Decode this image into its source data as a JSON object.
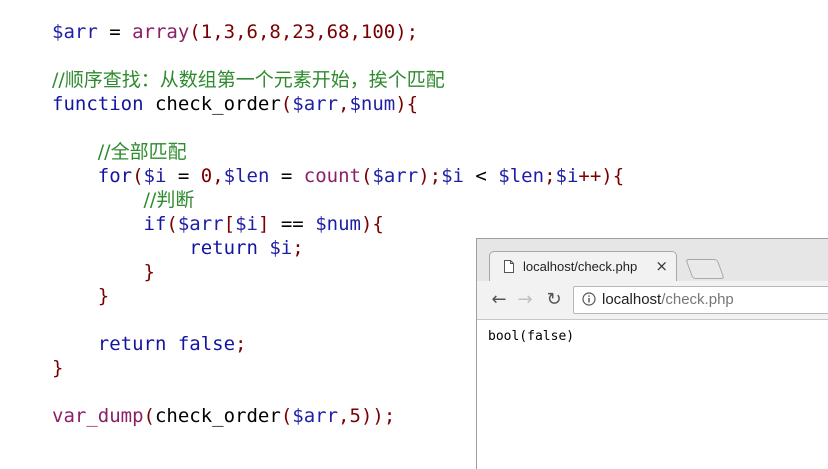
{
  "code_lines": [
    {
      "tokens": [
        [
          "v",
          "$arr"
        ],
        [
          "t",
          " = "
        ],
        [
          "f",
          "array"
        ],
        [
          "p",
          "("
        ],
        [
          "n",
          "1,3,6,8,23,68,100"
        ],
        [
          "p",
          ");"
        ]
      ]
    },
    {
      "tokens": []
    },
    {
      "tokens": [
        [
          "c",
          "//顺序查找：从数组第一个元素开始，挨个匹配"
        ]
      ]
    },
    {
      "tokens": [
        [
          "k",
          "function "
        ],
        [
          "t",
          "check_order"
        ],
        [
          "p",
          "("
        ],
        [
          "v",
          "$arr"
        ],
        [
          "p",
          ","
        ],
        [
          "v",
          "$num"
        ],
        [
          "p",
          "){"
        ]
      ]
    },
    {
      "tokens": []
    },
    {
      "tokens": [
        [
          "t",
          "    "
        ],
        [
          "c",
          "//全部匹配"
        ]
      ]
    },
    {
      "tokens": [
        [
          "t",
          "    "
        ],
        [
          "k",
          "for"
        ],
        [
          "p",
          "("
        ],
        [
          "v",
          "$i"
        ],
        [
          "t",
          " = "
        ],
        [
          "n",
          "0"
        ],
        [
          "p",
          ","
        ],
        [
          "v",
          "$len"
        ],
        [
          "t",
          " = "
        ],
        [
          "f",
          "count"
        ],
        [
          "p",
          "("
        ],
        [
          "v",
          "$arr"
        ],
        [
          "p",
          ");"
        ],
        [
          "v",
          "$i"
        ],
        [
          "t",
          " < "
        ],
        [
          "v",
          "$len"
        ],
        [
          "p",
          ";"
        ],
        [
          "v",
          "$i"
        ],
        [
          "p",
          "++){"
        ]
      ]
    },
    {
      "tokens": [
        [
          "t",
          "        "
        ],
        [
          "c",
          "//判断"
        ]
      ]
    },
    {
      "tokens": [
        [
          "t",
          "        "
        ],
        [
          "k",
          "if"
        ],
        [
          "p",
          "("
        ],
        [
          "v",
          "$arr"
        ],
        [
          "p",
          "["
        ],
        [
          "v",
          "$i"
        ],
        [
          "p",
          "]"
        ],
        [
          "t",
          " == "
        ],
        [
          "v",
          "$num"
        ],
        [
          "p",
          "){"
        ]
      ]
    },
    {
      "tokens": [
        [
          "t",
          "            "
        ],
        [
          "k",
          "return "
        ],
        [
          "v",
          "$i"
        ],
        [
          "p",
          ";"
        ]
      ]
    },
    {
      "tokens": [
        [
          "t",
          "        "
        ],
        [
          "p",
          "}"
        ]
      ]
    },
    {
      "tokens": [
        [
          "t",
          "    "
        ],
        [
          "p",
          "}"
        ]
      ]
    },
    {
      "tokens": []
    },
    {
      "tokens": [
        [
          "t",
          "    "
        ],
        [
          "k",
          "return false"
        ],
        [
          "p",
          ";"
        ]
      ]
    },
    {
      "tokens": [
        [
          "p",
          "}"
        ]
      ]
    },
    {
      "tokens": []
    },
    {
      "tokens": [
        [
          "f",
          "var_dump"
        ],
        [
          "p",
          "("
        ],
        [
          "t",
          "check_order"
        ],
        [
          "p",
          "("
        ],
        [
          "v",
          "$arr"
        ],
        [
          "p",
          ","
        ],
        [
          "n",
          "5"
        ],
        [
          "p",
          "));"
        ]
      ]
    }
  ],
  "browser": {
    "tab_title": "localhost/check.php",
    "tab_icon": "page-icon",
    "close_glyph": "×",
    "back_glyph": "←",
    "forward_glyph": "→",
    "reload_glyph": "↻",
    "url_host": "localhost",
    "url_path": "/check.php",
    "page_output": "bool(false)"
  }
}
